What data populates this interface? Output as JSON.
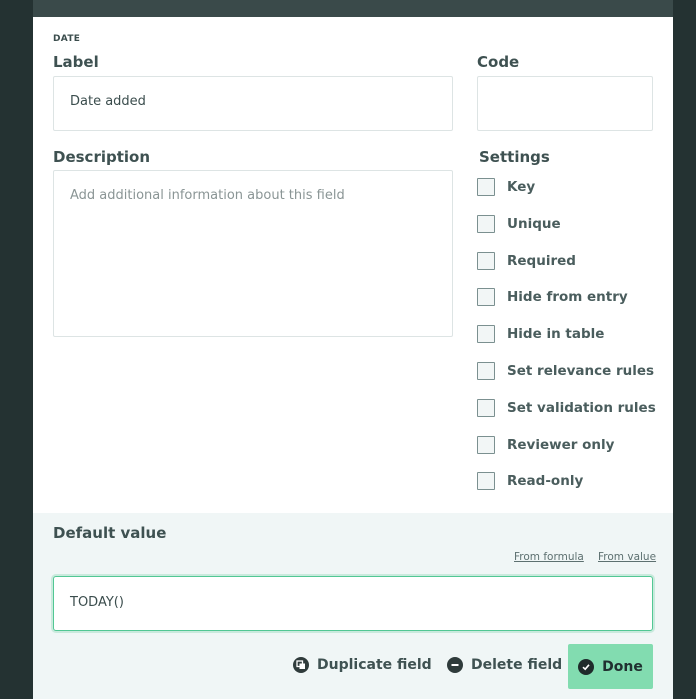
{
  "field": {
    "type": "DATE",
    "label_title": "Label",
    "label_value": "Date added",
    "code_title": "Code",
    "code_value": "",
    "description_title": "Description",
    "description_placeholder": "Add additional information about this field"
  },
  "settings": {
    "title": "Settings",
    "items": [
      {
        "label": "Key",
        "checked": false
      },
      {
        "label": "Unique",
        "checked": false
      },
      {
        "label": "Required",
        "checked": false
      },
      {
        "label": "Hide from entry",
        "checked": false
      },
      {
        "label": "Hide in table",
        "checked": false
      },
      {
        "label": "Set relevance rules",
        "checked": false
      },
      {
        "label": "Set validation rules",
        "checked": false
      },
      {
        "label": "Reviewer only",
        "checked": false
      },
      {
        "label": "Read-only",
        "checked": false
      }
    ]
  },
  "default_value": {
    "title": "Default value",
    "from_formula": "From formula",
    "from_value": "From value",
    "formula": "TODAY()"
  },
  "actions": {
    "duplicate": "Duplicate field",
    "delete": "Delete field",
    "done": "Done"
  },
  "colors": {
    "accent": "#82dcb0",
    "focus_border": "#52c794",
    "background": "#243232"
  }
}
